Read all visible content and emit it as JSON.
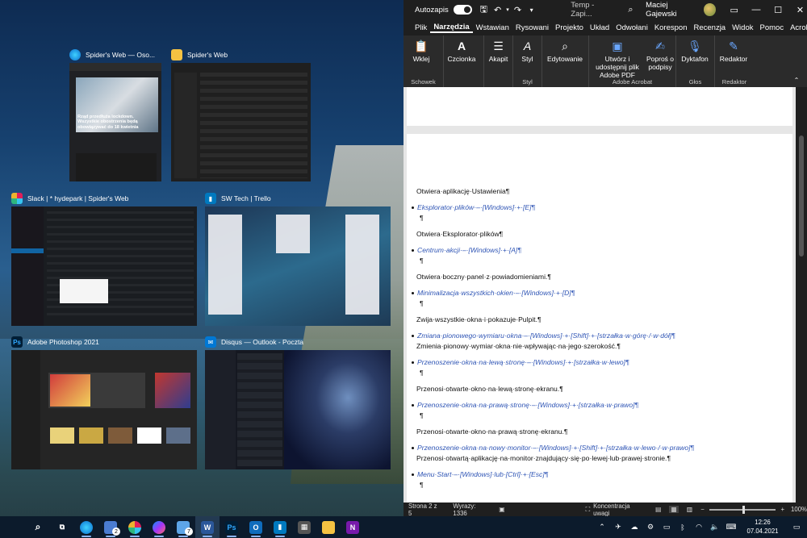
{
  "taskview": {
    "windows": [
      {
        "title": "Spider's Web — Oso...",
        "icon": "edge-icon",
        "hero_text": "Rząd przedłuża lockdown. Wszystkie obostrzenia będą obowiązywać do 18 kwietnia"
      },
      {
        "title": "Spider's Web",
        "icon": "folder-icon"
      },
      {
        "title": "Slack | * hydepark | Spider's Web",
        "icon": "slack-icon"
      },
      {
        "title": "SW Tech | Trello",
        "icon": "trello-icon"
      },
      {
        "title": "Adobe Photoshop 2021",
        "icon": "photoshop-icon"
      },
      {
        "title": "Disqus — Outlook - Poczta",
        "icon": "mail-icon"
      }
    ]
  },
  "word": {
    "titlebar": {
      "autosave_label": "Autozapis",
      "doc_title": "Temp - Zapi...",
      "user": "Maciej Gajewski"
    },
    "tabs": [
      "Plik",
      "Narzędzia",
      "Wstawian",
      "Rysowani",
      "Projekto",
      "Układ",
      "Odwołani",
      "Korespon",
      "Recenzja",
      "Widok",
      "Pomoc",
      "Acrobat"
    ],
    "ribbon": {
      "clipboard": {
        "button": "Wklej",
        "group": "Schowek"
      },
      "font": {
        "button": "Czcionka"
      },
      "paragraph": {
        "button": "Akapit"
      },
      "styles": {
        "button": "Styl",
        "group": "Styl"
      },
      "editing": {
        "button": "Edytowanie"
      },
      "acrobat": {
        "create": "Utwórz i udostępnij plik Adobe PDF",
        "request": "Poproś o podpisy",
        "group": "Adobe Acrobat"
      },
      "voice": {
        "button": "Dyktafon",
        "group": "Głos"
      },
      "editor": {
        "button": "Redaktor",
        "group": "Redaktor"
      }
    },
    "document": {
      "paragraphs": [
        {
          "type": "text",
          "text": "Otwiera·aplikację·Ustawienia¶"
        },
        {
          "type": "link",
          "text": "Eksplorator·plików·–·[Windows]·+·[E]¶"
        },
        {
          "type": "pilcrow",
          "text": "¶"
        },
        {
          "type": "text",
          "text": "Otwiera·Eksplorator·plików¶"
        },
        {
          "type": "link",
          "text": "Centrum·akcji·–·[Windows]·+·[A]¶"
        },
        {
          "type": "pilcrow",
          "text": "¶"
        },
        {
          "type": "text",
          "text": "Otwiera·boczny·panel·z·powiadomieniami.¶"
        },
        {
          "type": "link",
          "text": "Minimalizacja·wszystkich·okien·–·[Windows]·+·[D]¶"
        },
        {
          "type": "pilcrow",
          "text": "¶"
        },
        {
          "type": "text",
          "text": "Zwija·wszystkie·okna·i·pokazuje·Pulpit.¶"
        },
        {
          "type": "link",
          "text": "Zmiana·pionowego·wymiaru·okna·–·[Windows]·+·[Shift]·+·[strzałka·w·górę·/·w·dół]¶"
        },
        {
          "type": "text",
          "text": "Zmienia·pionowy·wymiar·okna·nie·wpływając·na·jego·szerokość.¶"
        },
        {
          "type": "link",
          "text": "Przenoszenie·okna·na·lewą·stronę·–·[Windows]·+·[strzałka·w·lewo]¶"
        },
        {
          "type": "pilcrow",
          "text": "¶"
        },
        {
          "type": "text",
          "text": "Przenosi·otwarte·okno·na·lewą·stronę·ekranu.¶"
        },
        {
          "type": "link",
          "text": "Przenoszenie·okna·na·prawą·stronę·–·[Windows]·+·[strzałka·w·prawo]¶"
        },
        {
          "type": "pilcrow",
          "text": "¶"
        },
        {
          "type": "text",
          "text": "Przenosi·otwarte·okno·na·prawą·stronę·ekranu.¶"
        },
        {
          "type": "link",
          "text": "Przenoszenie·okna·na·nowy·monitor·–·[Windows]·+·[Shift]·+·[strzałka·w·lewo·/·w·prawo]¶"
        },
        {
          "type": "text",
          "text": "Przenosi·otwartą·aplikację·na·monitor·znajdujący·się·po·lewej·lub·prawej·stronie.¶"
        },
        {
          "type": "link",
          "text": "Menu·Start·–·[Windows]·lub·[Ctrl]·+·[Esc]¶"
        },
        {
          "type": "pilcrow",
          "text": "¶"
        }
      ]
    },
    "status": {
      "page": "Strona 2 z 5",
      "words": "Wyrazy: 1336",
      "focus": "Koncentracja uwagi",
      "zoom": "100%"
    }
  },
  "taskbar": {
    "apps": [
      {
        "name": "task-view",
        "icon": "task-view-icon"
      },
      {
        "name": "edge",
        "icon": "edge-icon",
        "open": true
      },
      {
        "name": "app-2",
        "icon": "chat-icon",
        "badge": "2",
        "open": true
      },
      {
        "name": "slack",
        "icon": "slack-icon",
        "open": true
      },
      {
        "name": "messenger",
        "icon": "messenger-icon",
        "open": true
      },
      {
        "name": "explorer",
        "icon": "file-explorer-icon",
        "badge": "7",
        "open": true
      },
      {
        "name": "word",
        "icon": "word-icon",
        "open": true
      },
      {
        "name": "photoshop",
        "icon": "photoshop-icon",
        "open": true
      },
      {
        "name": "outlook",
        "icon": "outlook-icon",
        "open": true
      },
      {
        "name": "trello",
        "icon": "trello-icon",
        "open": true
      },
      {
        "name": "calculator",
        "icon": "calculator-icon"
      },
      {
        "name": "folder",
        "icon": "folder-icon"
      },
      {
        "name": "onenote",
        "icon": "onenote-icon"
      }
    ],
    "clock": {
      "time": "12:26",
      "date": "07.04.2021"
    }
  },
  "colors": {
    "word_blue": "#2b579a",
    "link_text": "#2f55b5",
    "taskbar_bg": "#0c1b2c"
  }
}
